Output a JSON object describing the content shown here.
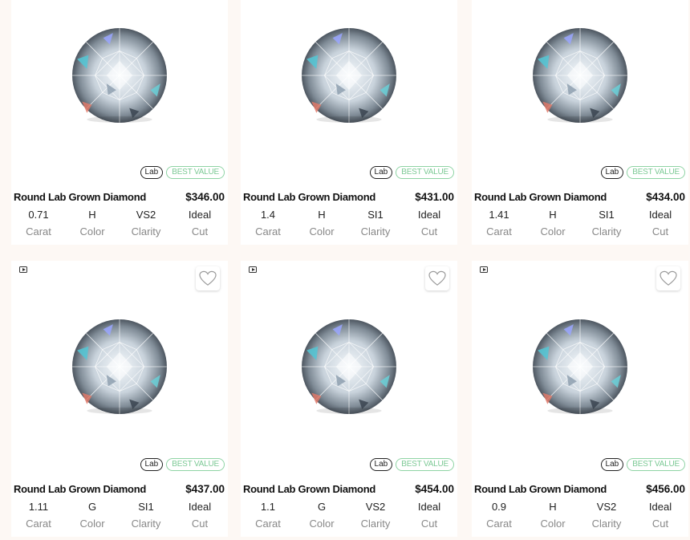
{
  "colors": {
    "page_background": "#fdf8f4",
    "card_background": "#ffffff",
    "best_value_green": "#7cc995",
    "label_gray": "#888888"
  },
  "products": [
    {
      "title": "Round Lab Grown Diamond",
      "price": "$346.00",
      "badge_type": "Lab",
      "badge_value": "BEST VALUE",
      "specs": [
        {
          "value": "0.71",
          "label": "Carat"
        },
        {
          "value": "H",
          "label": "Color"
        },
        {
          "value": "VS2",
          "label": "Clarity"
        },
        {
          "value": "Ideal",
          "label": "Cut"
        }
      ]
    },
    {
      "title": "Round Lab Grown Diamond",
      "price": "$431.00",
      "badge_type": "Lab",
      "badge_value": "BEST VALUE",
      "specs": [
        {
          "value": "1.4",
          "label": "Carat"
        },
        {
          "value": "H",
          "label": "Color"
        },
        {
          "value": "SI1",
          "label": "Clarity"
        },
        {
          "value": "Ideal",
          "label": "Cut"
        }
      ]
    },
    {
      "title": "Round Lab Grown Diamond",
      "price": "$434.00",
      "badge_type": "Lab",
      "badge_value": "BEST VALUE",
      "specs": [
        {
          "value": "1.41",
          "label": "Carat"
        },
        {
          "value": "H",
          "label": "Color"
        },
        {
          "value": "SI1",
          "label": "Clarity"
        },
        {
          "value": "Ideal",
          "label": "Cut"
        }
      ]
    },
    {
      "title": "Round Lab Grown Diamond",
      "price": "$437.00",
      "badge_type": "Lab",
      "badge_value": "BEST VALUE",
      "icons": [
        "video-icon",
        "heart-icon"
      ],
      "specs": [
        {
          "value": "1.11",
          "label": "Carat"
        },
        {
          "value": "G",
          "label": "Color"
        },
        {
          "value": "SI1",
          "label": "Clarity"
        },
        {
          "value": "Ideal",
          "label": "Cut"
        }
      ]
    },
    {
      "title": "Round Lab Grown Diamond",
      "price": "$454.00",
      "badge_type": "Lab",
      "badge_value": "BEST VALUE",
      "icons": [
        "video-icon",
        "heart-icon"
      ],
      "specs": [
        {
          "value": "1.1",
          "label": "Carat"
        },
        {
          "value": "G",
          "label": "Color"
        },
        {
          "value": "VS2",
          "label": "Clarity"
        },
        {
          "value": "Ideal",
          "label": "Cut"
        }
      ]
    },
    {
      "title": "Round Lab Grown Diamond",
      "price": "$456.00",
      "badge_type": "Lab",
      "badge_value": "BEST VALUE",
      "icons": [
        "video-icon",
        "heart-icon"
      ],
      "specs": [
        {
          "value": "0.9",
          "label": "Carat"
        },
        {
          "value": "H",
          "label": "Color"
        },
        {
          "value": "VS2",
          "label": "Clarity"
        },
        {
          "value": "Ideal",
          "label": "Cut"
        }
      ]
    }
  ]
}
